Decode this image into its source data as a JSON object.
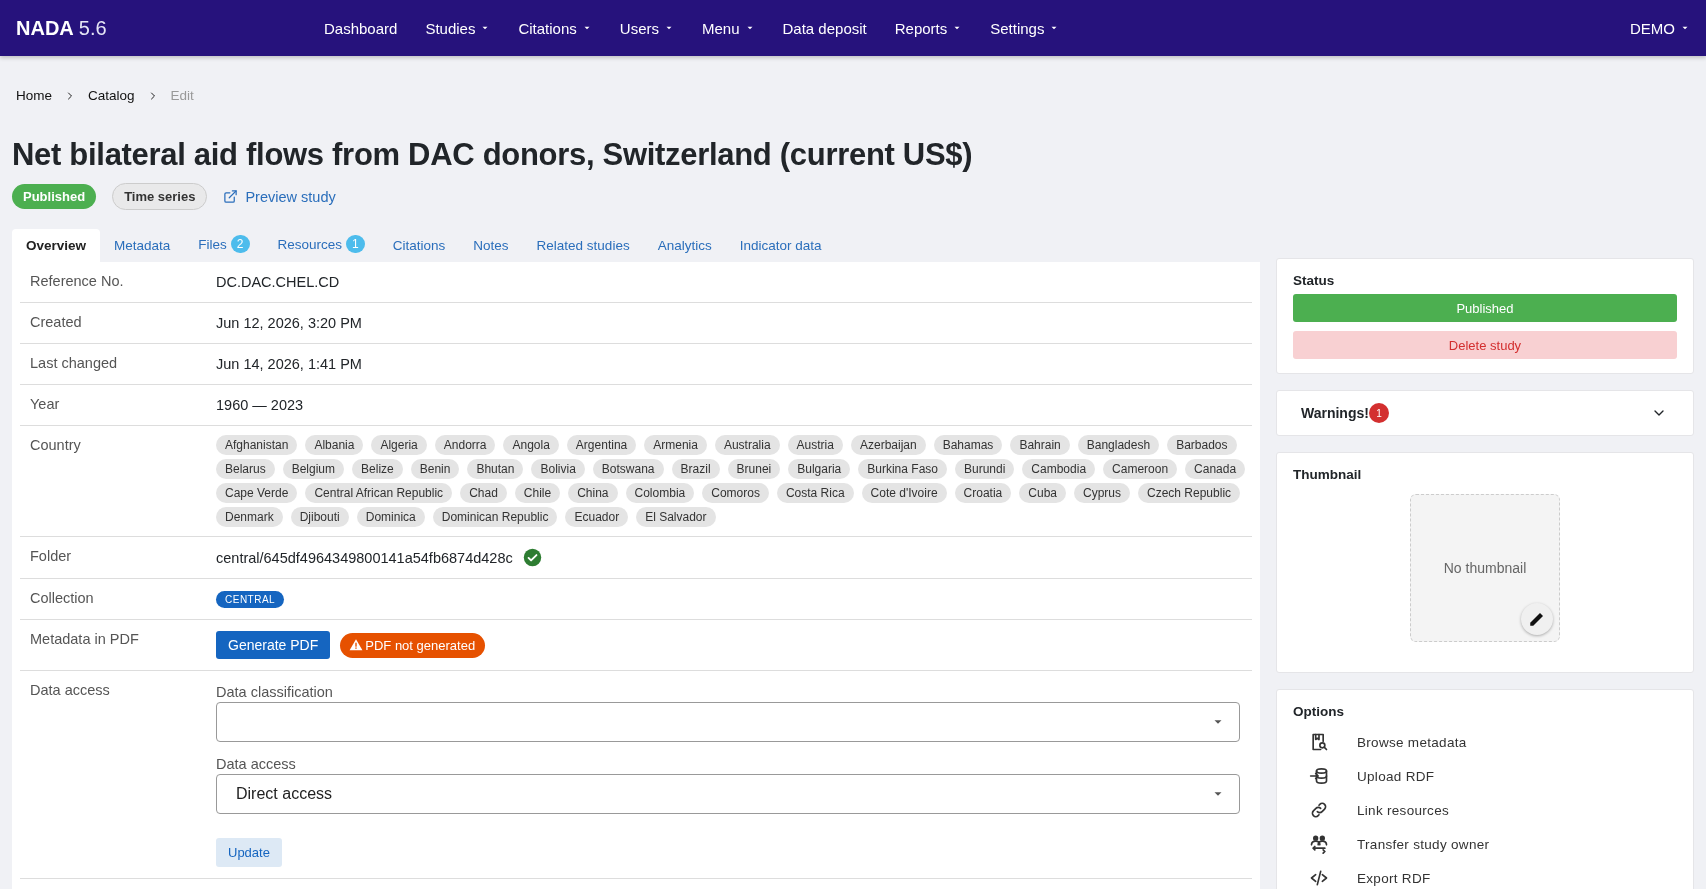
{
  "navbar": {
    "brand": "NADA",
    "version": "5.6",
    "items": [
      {
        "label": "Dashboard",
        "dropdown": false
      },
      {
        "label": "Studies",
        "dropdown": true
      },
      {
        "label": "Citations",
        "dropdown": true
      },
      {
        "label": "Users",
        "dropdown": true
      },
      {
        "label": "Menu",
        "dropdown": true
      },
      {
        "label": "Data deposit",
        "dropdown": false
      },
      {
        "label": "Reports",
        "dropdown": true
      },
      {
        "label": "Settings",
        "dropdown": true
      }
    ],
    "user": {
      "label": "DEMO",
      "dropdown": true
    }
  },
  "breadcrumb": [
    {
      "label": "Home",
      "current": false
    },
    {
      "label": "Catalog",
      "current": false
    },
    {
      "label": "Edit",
      "current": true
    }
  ],
  "title": "Net bilateral aid flows from DAC donors, Switzerland (current US$)",
  "badges": [
    {
      "label": "Published",
      "kind": "status"
    },
    {
      "label": "Time series",
      "kind": "type"
    }
  ],
  "preview_link": "Preview study",
  "tabs": [
    {
      "label": "Overview",
      "selected": true
    },
    {
      "label": "Metadata",
      "selected": false
    },
    {
      "label": "Files",
      "count": "2",
      "selected": false
    },
    {
      "label": "Resources",
      "count": "1",
      "selected": false
    },
    {
      "label": "Citations",
      "selected": false
    },
    {
      "label": "Notes",
      "selected": false
    },
    {
      "label": "Related studies",
      "selected": false
    },
    {
      "label": "Analytics",
      "selected": false
    },
    {
      "label": "Indicator data",
      "selected": false
    }
  ],
  "overview": [
    {
      "kind": "text",
      "label": "Reference No.",
      "value": "DC.DAC.CHEL.CD"
    },
    {
      "kind": "text",
      "label": "Created",
      "value": "Jun 12, 2026, 3:20 PM"
    },
    {
      "kind": "text",
      "label": "Last changed",
      "value": "Jun 14, 2026, 1:41 PM"
    },
    {
      "kind": "text",
      "label": "Year",
      "value": "1960 — 2023"
    },
    {
      "kind": "chips",
      "label": "Country",
      "values": [
        "Afghanistan",
        "Albania",
        "Algeria",
        "Andorra",
        "Angola",
        "Argentina",
        "Armenia",
        "Australia",
        "Austria",
        "Azerbaijan",
        "Bahamas",
        "Bahrain",
        "Bangladesh",
        "Barbados",
        "Belarus",
        "Belgium",
        "Belize",
        "Benin",
        "Bhutan",
        "Bolivia",
        "Botswana",
        "Brazil",
        "Brunei",
        "Bulgaria",
        "Burkina Faso",
        "Burundi",
        "Cambodia",
        "Cameroon",
        "Canada",
        "Cape Verde",
        "Central African Republic",
        "Chad",
        "Chile",
        "China",
        "Colombia",
        "Comoros",
        "Costa Rica",
        "Cote d'Ivoire",
        "Croatia",
        "Cuba",
        "Cyprus",
        "Czech Republic",
        "Denmark",
        "Djibouti",
        "Dominica",
        "Dominican Republic",
        "Ecuador",
        "El Salvador"
      ]
    },
    {
      "kind": "folder",
      "label": "Folder",
      "value": "central/645df4964349800141a54fb6874d428c",
      "verified": true
    },
    {
      "kind": "tag",
      "label": "Collection",
      "value": "CENTRAL"
    },
    {
      "kind": "pdf",
      "label": "Metadata in PDF",
      "button": "Generate PDF",
      "warning": "PDF not generated"
    },
    {
      "kind": "access",
      "label": "Data access",
      "fields": [
        {
          "label": "Data classification"
        },
        {
          "label": "Data access",
          "value": "Direct access"
        }
      ],
      "button": "Update"
    }
  ],
  "status_card": {
    "title": "Status",
    "status_button": "Published",
    "delete_button": "Delete study"
  },
  "warnings": {
    "title": "Warnings!",
    "count": "1",
    "expanded": false
  },
  "thumbnail": {
    "title": "Thumbnail",
    "placeholder": "No thumbnail"
  },
  "options": {
    "title": "Options",
    "items": [
      {
        "label": "Browse metadata",
        "kind": "browse"
      },
      {
        "label": "Upload RDF",
        "kind": "upload"
      },
      {
        "label": "Link resources",
        "kind": "link"
      },
      {
        "label": "Transfer study owner",
        "kind": "transfer"
      },
      {
        "label": "Export RDF",
        "kind": "export"
      }
    ]
  }
}
